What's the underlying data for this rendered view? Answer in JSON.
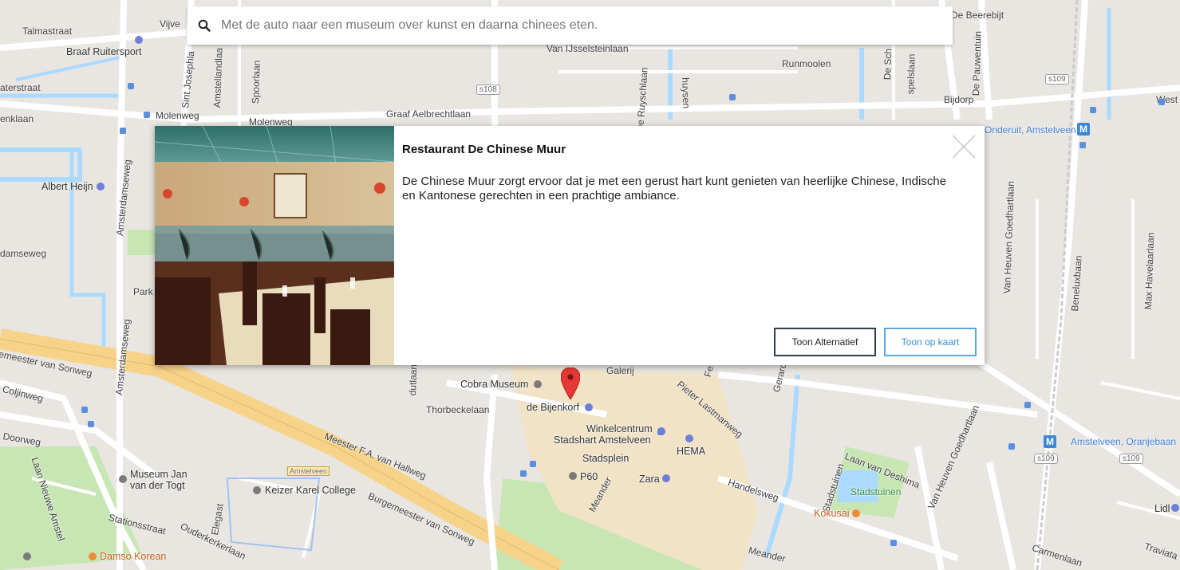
{
  "search": {
    "placeholder": "Met de auto naar een museum over kunst en daarna chinees eten."
  },
  "card": {
    "title": "Restaurant De Chinese Muur",
    "description": "De Chinese Muur zorgt ervoor dat je met een gerust hart kunt genieten van heerlijke Chinese, Indische en Kantonese gerechten in een prachtige ambiance.",
    "button_alternative": "Toon Alternatief",
    "button_map": "Toon op kaart"
  },
  "map": {
    "labels": {
      "talmastraat": "Talmastraat",
      "braaf": "Braaf Ruitersport",
      "vijve": "Vijve",
      "aterstraat": "aterstraat",
      "enklaan": "enklaan",
      "molenweg1": "Molenweg",
      "molenweg2": "Molenweg",
      "albert_heijn": "Albert Heijn",
      "damseweg": "damseweg",
      "park": "Park",
      "meester_sonweg": "emeester van Sonweg",
      "coljinweg": "Coljinweg",
      "doorweg": "Doorweg",
      "amsterdamseweg": "Amsterdamseweg",
      "amsterdamseweg2": "Amsterdamseweg",
      "sint_joseph": "Sint Josephla",
      "amstellandlaan": "Amstellandlaa",
      "spoorlaan": "Spoorlaan",
      "graaf": "Graaf Aelbrechtlaan",
      "s108": "s108",
      "van_ijssel": "Van IJsselsteinlaan",
      "runmoolen": "Runmoolen",
      "ruyschlaan": "De Ruyschlaan",
      "huysen": "huysen",
      "de_beerebijt": "De Beerebijt",
      "de_pauwentuin": "De Pauwentuin",
      "de_sch": "De Sch",
      "spelslaan": "spelslaan",
      "bijdorp": "Bijdorp",
      "west": "West",
      "s109a": "s109",
      "onderuit": "Onderuit, Amstelveen",
      "van_heuven1": "Van Heuven Goedhartlaan",
      "beneluxbaan": "Beneluxbaan",
      "max_havelaar": "Max Havelaarlaan",
      "cobra": "Cobra Museum",
      "bijenkorf": "de Bijenkorf",
      "galerij": "Galerij",
      "winkelcentrum": "Winkelcentrum",
      "stadshart": "Stadshart Amstelveen",
      "hema": "HEMA",
      "stadsplein": "Stadsplein",
      "p60": "P60",
      "zara": "Zara",
      "pieter": "Pieter Lastmanweg",
      "thorbecke": "Thorbeckelaan",
      "meester_fa": "Meester F.A. van Hallweg",
      "burgemeester": "Burgemeester van Sonweg",
      "amstelveen_5": "Amstelveen",
      "keizer": "Keizer Karel College",
      "museum_jan1": "Museum Jan",
      "museum_jan2": "van der Togt",
      "stationsstraat": "Stationsstraat",
      "elegast": "Elegast",
      "ouderkerk": "Ouderkerkerlaan",
      "damso": "Damso Korean",
      "laan_nieuwe": "Laan Nieuwe Amstel",
      "meander1": "Meander",
      "meander2": "Meander",
      "handelsweg": "Handelsweg",
      "stadstuinen1": "Stadstuinen",
      "stadstuinen2": "Stadstuinen",
      "kokusai": "Kokusai",
      "laan_deshima": "Laan van Deshima",
      "van_heuven2": "Van Heuven Goedhartlaan",
      "amstelveen_oranje": "Amstelveen, Oranjebaan",
      "s109b": "s109",
      "s109c": "s109",
      "lidl": "Lidl",
      "carmenlaan": "Carmenlaan",
      "traviata": "Traviata",
      "gerard": "Gerard",
      "dutlaan": "dutlaan",
      "fe": "Fe"
    },
    "colors": {
      "background": "#e9e6e1",
      "water": "#aadaff",
      "park": "#c8e6b4",
      "shopping": "#f2e3c7",
      "highway": "#f7d38a",
      "road": "#ffffff",
      "pin": "#e53935"
    }
  },
  "icons": {
    "search": "search-icon",
    "close": "close-icon",
    "pin": "map-pin-icon"
  }
}
